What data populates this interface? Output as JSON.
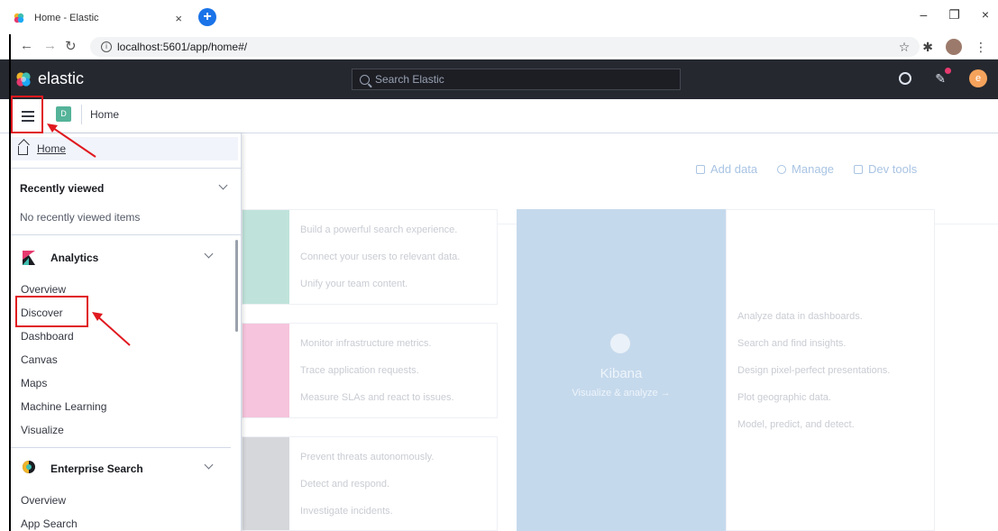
{
  "browser": {
    "tab_title": "Home - Elastic",
    "tab_close": "×",
    "new_tab": "+",
    "url": "localhost:5601/app/home#/",
    "window_controls": [
      "–",
      "❐",
      "×"
    ]
  },
  "header": {
    "brand": "elastic",
    "search_placeholder": "Search Elastic",
    "user_initial": "e"
  },
  "breadcrumb": {
    "space_initial": "D",
    "current": "Home"
  },
  "sidenav": {
    "home_label": "Home",
    "recently_viewed": {
      "title": "Recently viewed",
      "empty_text": "No recently viewed items"
    },
    "analytics": {
      "title": "Analytics",
      "items": [
        "Overview",
        "Discover",
        "Dashboard",
        "Canvas",
        "Maps",
        "Machine Learning",
        "Visualize"
      ]
    },
    "enterprise_search": {
      "title": "Enterprise Search",
      "items": [
        "Overview",
        "App Search"
      ]
    }
  },
  "home": {
    "top_links": [
      "Add data",
      "Manage",
      "Dev tools"
    ],
    "cards": [
      {
        "lines": [
          "Build a powerful search experience.",
          "Connect your users to relevant data.",
          "Unify your team content."
        ],
        "color": "#bfe3da"
      },
      {
        "lines": [
          "Monitor infrastructure metrics.",
          "Trace application requests.",
          "Measure SLAs and react to issues."
        ],
        "color": "#f6c4dc"
      },
      {
        "lines": [
          "Prevent threats autonomously.",
          "Detect and respond.",
          "Investigate incidents."
        ],
        "color": "#d5d7db"
      }
    ],
    "kibana": {
      "title": "Kibana",
      "link": "Visualize & analyze →",
      "lines": [
        "Analyze data in dashboards.",
        "Search and find insights.",
        "Design pixel-perfect presentations.",
        "Plot geographic data.",
        "Model, predict, and detect."
      ]
    }
  },
  "colors": {
    "header_bg": "#25282f",
    "annotation_red": "#e0191f",
    "space_avatar": "#54b399",
    "user_avatar": "#f5a35c"
  }
}
